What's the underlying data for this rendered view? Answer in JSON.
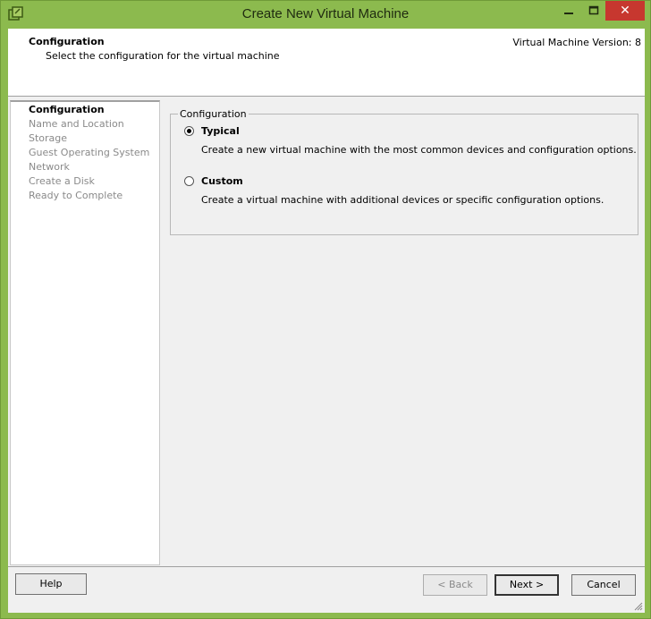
{
  "window": {
    "title": "Create New Virtual Machine",
    "icon": "vmware-vm-icon",
    "controls": {
      "minimize": "minimize-icon",
      "maximize": "maximize-icon",
      "close": "✕"
    },
    "accent_color": "#8cba4e",
    "close_color": "#c7372f"
  },
  "header": {
    "title": "Configuration",
    "subtitle": "Select the configuration for the virtual machine",
    "version": "Virtual Machine Version: 8"
  },
  "steps": [
    {
      "label": "Configuration",
      "active": true
    },
    {
      "label": "Name and Location",
      "active": false
    },
    {
      "label": "Storage",
      "active": false
    },
    {
      "label": "Guest Operating System",
      "active": false
    },
    {
      "label": "Network",
      "active": false
    },
    {
      "label": "Create a Disk",
      "active": false
    },
    {
      "label": "Ready to Complete",
      "active": false
    }
  ],
  "configuration": {
    "legend": "Configuration",
    "options": [
      {
        "label": "Typical",
        "description": "Create a new virtual machine with the most common devices and configuration options.",
        "selected": true
      },
      {
        "label": "Custom",
        "description": "Create a virtual machine with additional devices or specific configuration options.",
        "selected": false
      }
    ]
  },
  "buttons": {
    "help": "Help",
    "back": "< Back",
    "next": "Next >",
    "cancel": "Cancel"
  }
}
